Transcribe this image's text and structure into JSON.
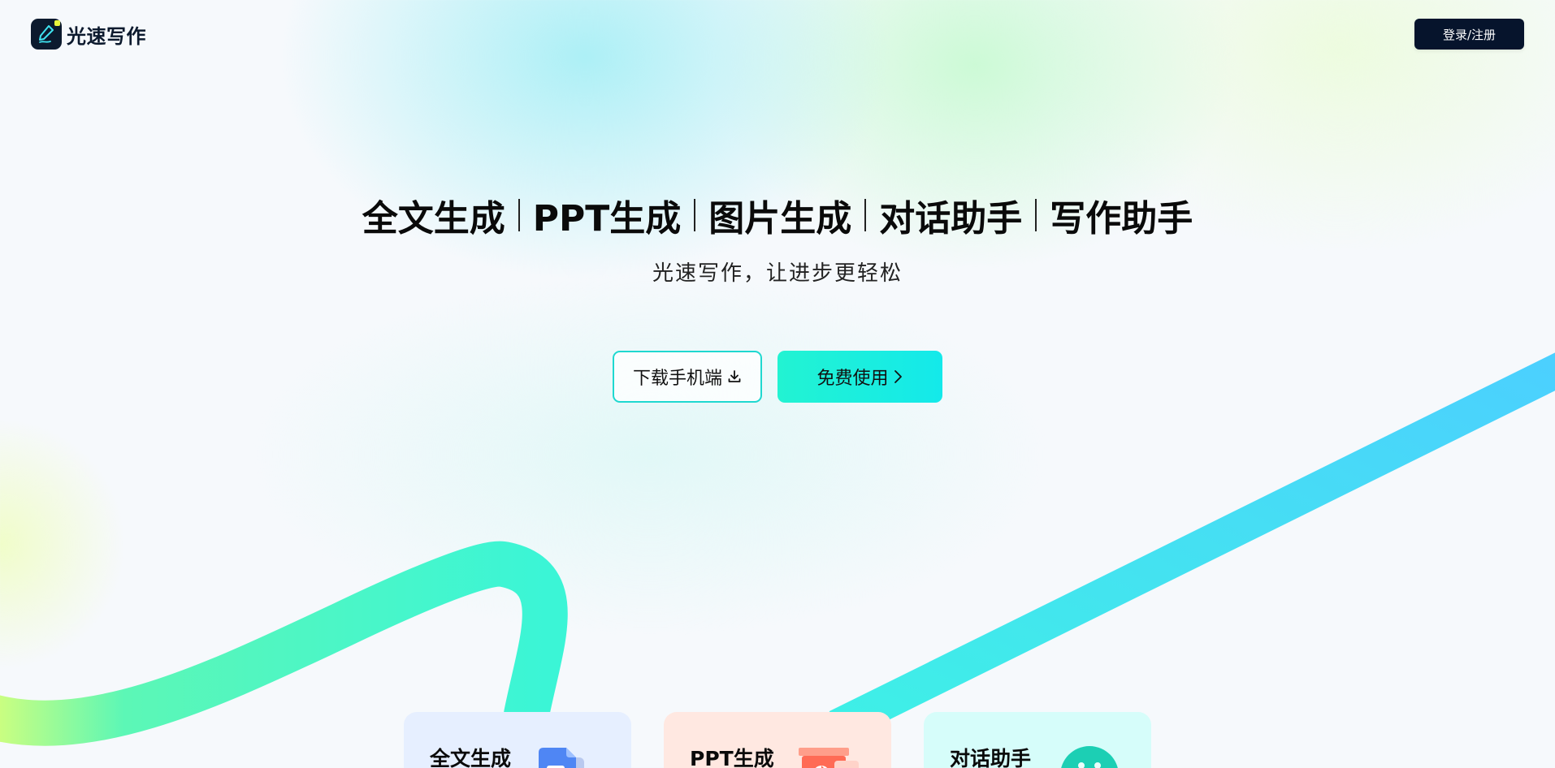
{
  "header": {
    "logo_text": "光速写作",
    "login_label": "登录/注册"
  },
  "hero": {
    "features": [
      "全文生成",
      "PPT生成",
      "图片生成",
      "对话助手",
      "写作助手"
    ],
    "subtitle": "光速写作，让进步更轻松",
    "download_label": "下载手机端",
    "free_label": "免费使用"
  },
  "cards": [
    {
      "title": "全文生成",
      "icon": "document-icon"
    },
    {
      "title": "PPT生成",
      "icon": "presentation-icon"
    },
    {
      "title": "对话助手",
      "icon": "chat-bot-icon"
    }
  ],
  "colors": {
    "dark": "#06142c",
    "accent": "#1fd8d0",
    "button_gradient_start": "#22f3d2",
    "button_gradient_end": "#14e9ea",
    "ribbon_green": "#3bf5d6",
    "ribbon_blue": "#4ccfff",
    "logo_dot": "#e9f53b"
  }
}
